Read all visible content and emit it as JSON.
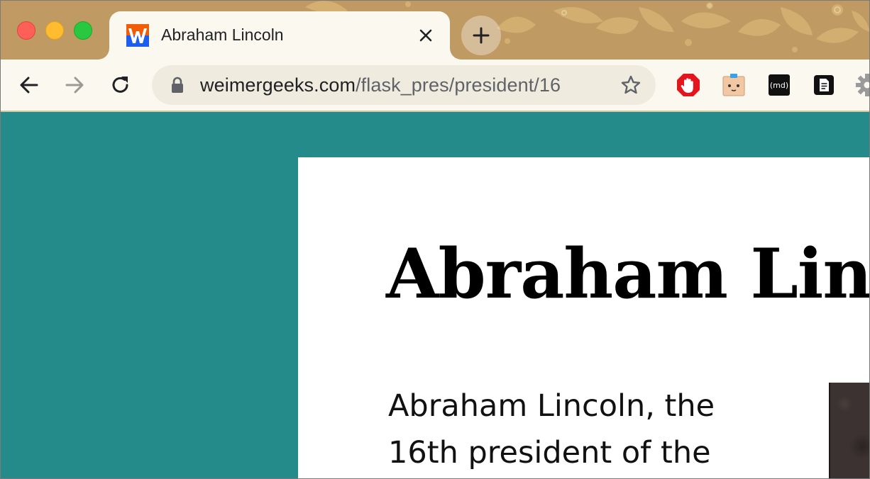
{
  "browser": {
    "tab": {
      "title": "Abraham Lincoln",
      "favicon": "weimergeeks-w-icon"
    },
    "address_bar": {
      "host": "weimergeeks.com",
      "path": "/flask_pres/president/16"
    },
    "extensions": [
      "adblock-hand-icon",
      "face-extension-icon",
      "markdown-md-icon",
      "document-icon",
      "gear-icon"
    ],
    "md_label": "(md)"
  },
  "page": {
    "heading": "Abraham Lincoln",
    "body_text": "Abraham Lincoln, the 16th president of the",
    "background_color": "#248a8a"
  }
}
